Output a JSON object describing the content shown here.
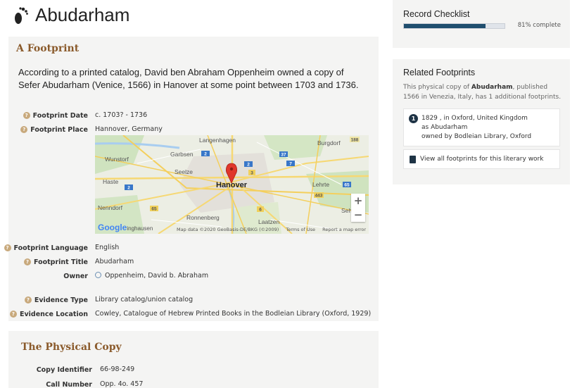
{
  "page": {
    "title": "Abudarham"
  },
  "footprint_card": {
    "heading": "A Footprint",
    "lead": "According to a printed catalog, David ben Abraham Oppenheim owned a copy of Sefer Abudarham (Venice, 1566) in Hanover at some point between 1703 and 1736.",
    "fields": {
      "date_label": "Footprint Date",
      "date_value": "c. 1703? - 1736",
      "place_label": "Footprint Place",
      "place_value": "Hannover, Germany",
      "language_label": "Footprint Language",
      "language_value": "English",
      "title_label": "Footprint Title",
      "title_value": "Abudarham",
      "owner_label": "Owner",
      "owner_value": "Oppenheim, David b. Abraham",
      "evidence_type_label": "Evidence Type",
      "evidence_type_value": "Library catalog/union catalog",
      "evidence_location_label": "Evidence Location",
      "evidence_location_value": "Cowley, Catalogue of Hebrew Printed Books in the Bodleian Library (Oxford, 1929)"
    }
  },
  "map": {
    "city_label": "Hanover",
    "labels": [
      "Langenhagen",
      "Burgdorf",
      "Garbsen",
      "Wunstorf",
      "Seelze",
      "Haste",
      "Lehrte",
      "Nenndorf",
      "Ronnenberg",
      "Laatzen",
      "Sehnde"
    ],
    "road_numbers": [
      "188",
      "2",
      "37",
      "7",
      "2",
      "3",
      "2",
      "65",
      "443",
      "65",
      "6"
    ],
    "zoom_in": "+",
    "zoom_out": "−",
    "google": "Google",
    "google_suffix": "inghausen",
    "attribution": "Map data ©2020 GeoBasis-DE/BKG (©2009)",
    "terms": "Terms of Use",
    "report": "Report a map error"
  },
  "physical_card": {
    "heading": "The Physical Copy",
    "copy_identifier_label": "Copy Identifier",
    "copy_identifier_value": "66-98-249",
    "call_number_label": "Call Number",
    "call_number_value": "Opp. 4o. 457"
  },
  "checklist": {
    "heading": "Record Checklist",
    "progress": 0.81,
    "progress_text": "81% complete"
  },
  "related": {
    "heading": "Related Footprints",
    "desc_prefix": "This physical copy of ",
    "desc_title": "Abudarham",
    "desc_suffix": ", published 1566 in Venezia, Italy, has 1 additional footprints.",
    "entry_number": "1",
    "entry_line1": "1829 , in Oxford, United Kingdom",
    "entry_line2": "as Abudarham",
    "entry_line3": "owned by Bodleian Library, Oxford",
    "view_all": "View all footprints for this literary work"
  },
  "colors": {
    "heading_brown": "#8a5a2b",
    "progress_fill": "#1f4e6e",
    "qmark": "#c8a97c",
    "pin_red": "#e0362b"
  }
}
